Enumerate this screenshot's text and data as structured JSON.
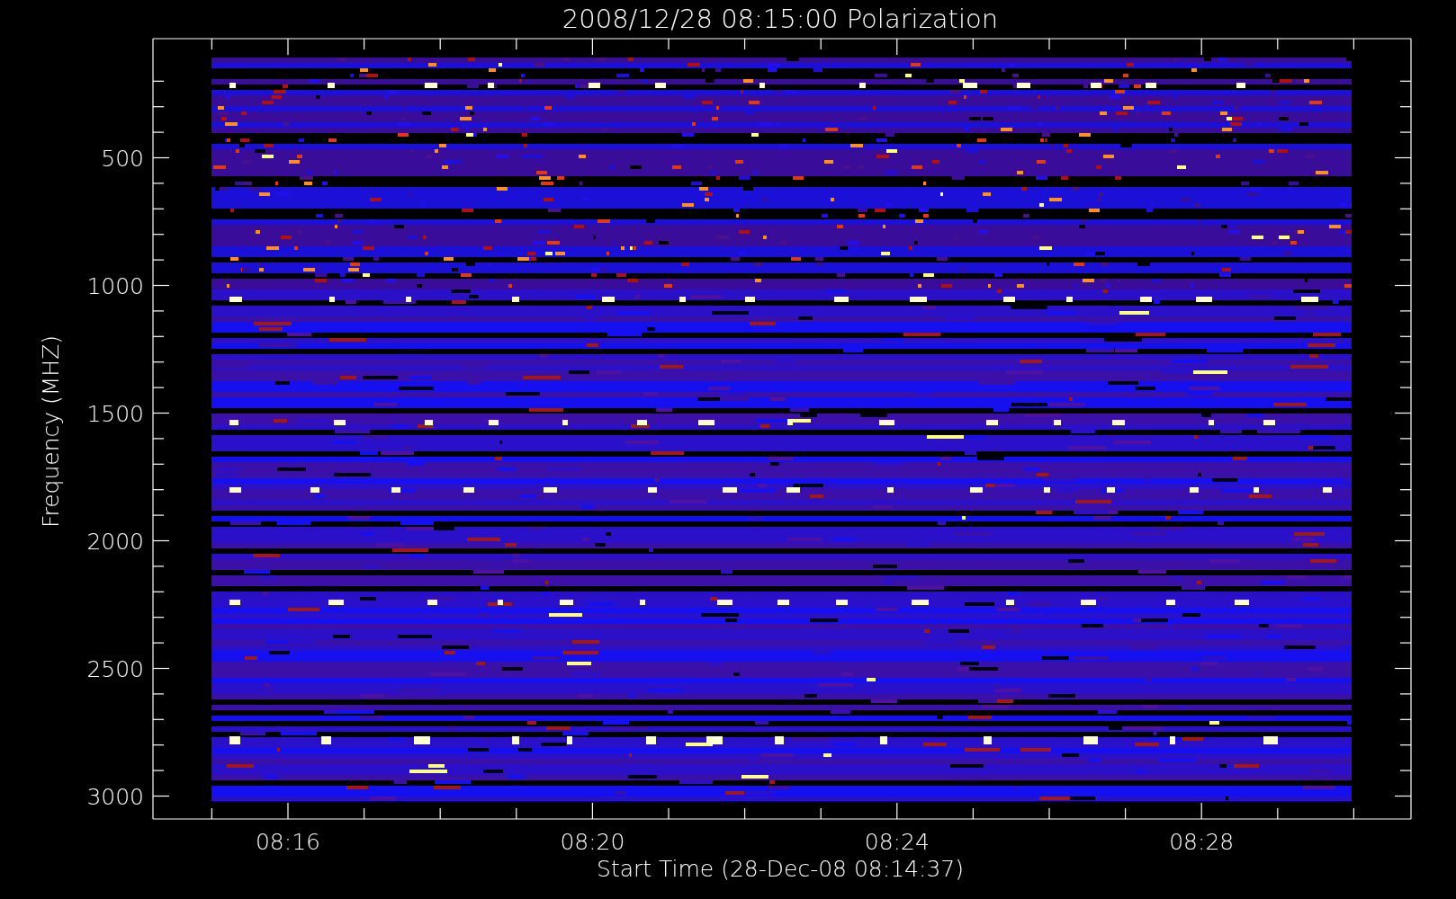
{
  "title": "2008/12/28 08:15:00 Polarization",
  "y_axis": {
    "label": "Frequency (MHZ)",
    "ticks": [
      "500",
      "1000",
      "1500",
      "2000",
      "2500",
      "3000"
    ]
  },
  "x_axis": {
    "label": "Start Time (28-Dec-08 08:14:37)",
    "ticks": [
      "08:16",
      "08:20",
      "08:24",
      "08:28"
    ]
  }
}
